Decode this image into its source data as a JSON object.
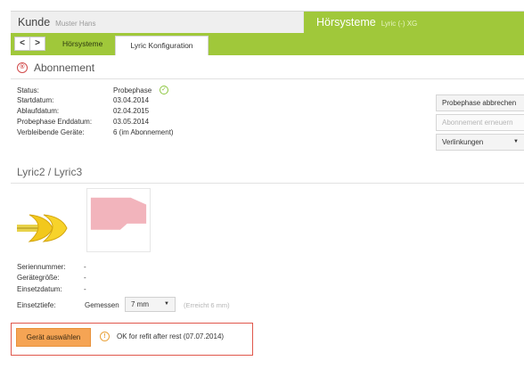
{
  "header": {
    "kunde_label": "Kunde",
    "kunde_name": "Muster Hans",
    "hoersysteme_label": "Hörsysteme",
    "hoersysteme_name": "Lyric (-) XG"
  },
  "nav": {
    "back": "<",
    "forward": ">"
  },
  "tabs": [
    {
      "label": "Hörsysteme"
    },
    {
      "label": "Lyric Konfiguration"
    }
  ],
  "abonnement": {
    "title": "Abonnement",
    "fields": [
      {
        "label": "Status:",
        "value": "Probephase"
      },
      {
        "label": "Startdatum:",
        "value": "03.04.2014"
      },
      {
        "label": "Ablaufdatum:",
        "value": "02.04.2015"
      },
      {
        "label": "Probephase Enddatum:",
        "value": "03.05.2014"
      },
      {
        "label": "Verbleibende Geräte:",
        "value": "6 (im Abonnement)"
      }
    ],
    "buttons": {
      "abbrechen": "Probephase abbrechen",
      "erneuern": "Abonnement erneuern",
      "verlinkungen": "Verlinkungen"
    }
  },
  "lyric": {
    "title": "Lyric2 / Lyric3",
    "fields": [
      {
        "label": "Seriennummer:",
        "value": "-"
      },
      {
        "label": "Gerätegröße:",
        "value": "-"
      },
      {
        "label": "Einsetzdatum:",
        "value": "-"
      },
      {
        "label": "Einsetztiefe:"
      }
    ],
    "gemessen_label": "Gemessen",
    "depth_value": "7 mm",
    "erreicht_text": "(Erreicht 6 mm)"
  },
  "action": {
    "button_label": "Gerät auswählen",
    "status_text": "OK for refit after rest (07.07.2014)"
  },
  "icons": {
    "section": "registered-icon",
    "status": "check-circle-icon",
    "warning": "warning-circle-icon"
  },
  "colors": {
    "accent_green": "#a0c83a",
    "orange_button": "#f5a454",
    "highlight_red": "#e0574b"
  }
}
